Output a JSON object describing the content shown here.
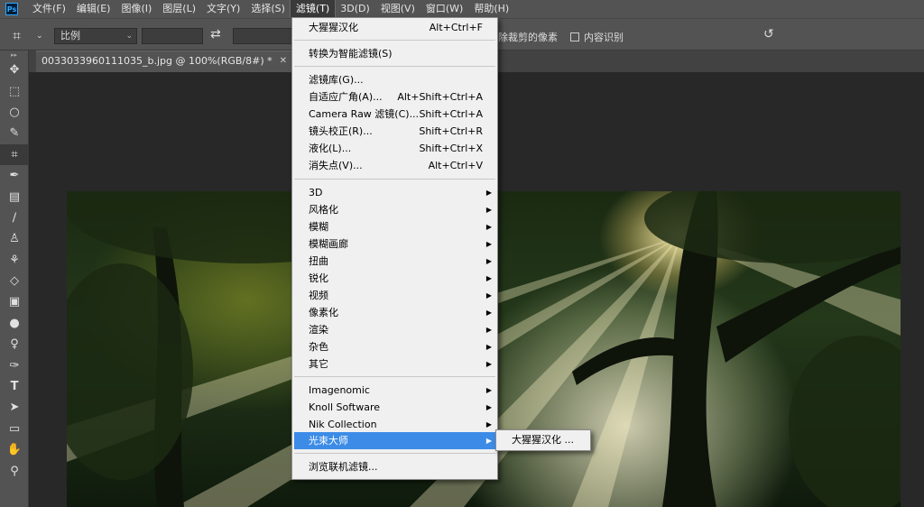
{
  "menubar": {
    "logo": "Ps",
    "items": [
      "文件(F)",
      "编辑(E)",
      "图像(I)",
      "图层(L)",
      "文字(Y)",
      "选择(S)",
      "滤镜(T)",
      "3D(D)",
      "视图(V)",
      "窗口(W)",
      "帮助(H)"
    ],
    "active_index": 6
  },
  "options": {
    "ratio_value": "比例",
    "delete_cropped_label": "除裁剪的像素",
    "content_aware_label": "内容识别"
  },
  "document": {
    "tab_title": "0033033960111035_b.jpg @ 100%(RGB/8#) *"
  },
  "filter_menu": {
    "items": [
      {
        "label": "大猩猩汉化",
        "shortcut": "Alt+Ctrl+F"
      },
      {
        "label": "转换为智能滤镜(S)"
      },
      {
        "label": "滤镜库(G)..."
      },
      {
        "label": "自适应广角(A)...",
        "shortcut": "Alt+Shift+Ctrl+A"
      },
      {
        "label": "Camera Raw 滤镜(C)...",
        "shortcut": "Shift+Ctrl+A"
      },
      {
        "label": "镜头校正(R)...",
        "shortcut": "Shift+Ctrl+R"
      },
      {
        "label": "液化(L)...",
        "shortcut": "Shift+Ctrl+X"
      },
      {
        "label": "消失点(V)...",
        "shortcut": "Alt+Ctrl+V"
      },
      {
        "label": "3D",
        "submenu": true
      },
      {
        "label": "风格化",
        "submenu": true
      },
      {
        "label": "模糊",
        "submenu": true
      },
      {
        "label": "模糊画廊",
        "submenu": true
      },
      {
        "label": "扭曲",
        "submenu": true
      },
      {
        "label": "锐化",
        "submenu": true
      },
      {
        "label": "视频",
        "submenu": true
      },
      {
        "label": "像素化",
        "submenu": true
      },
      {
        "label": "渲染",
        "submenu": true
      },
      {
        "label": "杂色",
        "submenu": true
      },
      {
        "label": "其它",
        "submenu": true
      },
      {
        "label": "Imagenomic",
        "submenu": true
      },
      {
        "label": "Knoll Software",
        "submenu": true
      },
      {
        "label": "Nik Collection",
        "submenu": true
      },
      {
        "label": "光束大师",
        "submenu": true,
        "highlighted": true
      },
      {
        "label": "浏览联机滤镜..."
      }
    ]
  },
  "submenu": {
    "items": [
      {
        "label": "大猩猩汉化 ..."
      }
    ]
  },
  "toolbar": {
    "tools": [
      "move-icon",
      "marquee-icon",
      "lasso-icon",
      "quick-select-icon",
      "crop-icon",
      "eyedropper-icon",
      "healing-icon",
      "brush-icon",
      "stamp-icon",
      "history-brush-icon",
      "eraser-icon",
      "gradient-icon",
      "blur-icon",
      "dodge-icon",
      "pen-icon",
      "type-icon",
      "path-select-icon",
      "rectangle-icon",
      "hand-icon",
      "zoom-icon"
    ],
    "selected_index": 4
  },
  "colors": {
    "accent_highlight": "#3c8ce7",
    "ui_panel": "#535353",
    "canvas_bg": "#282828"
  }
}
